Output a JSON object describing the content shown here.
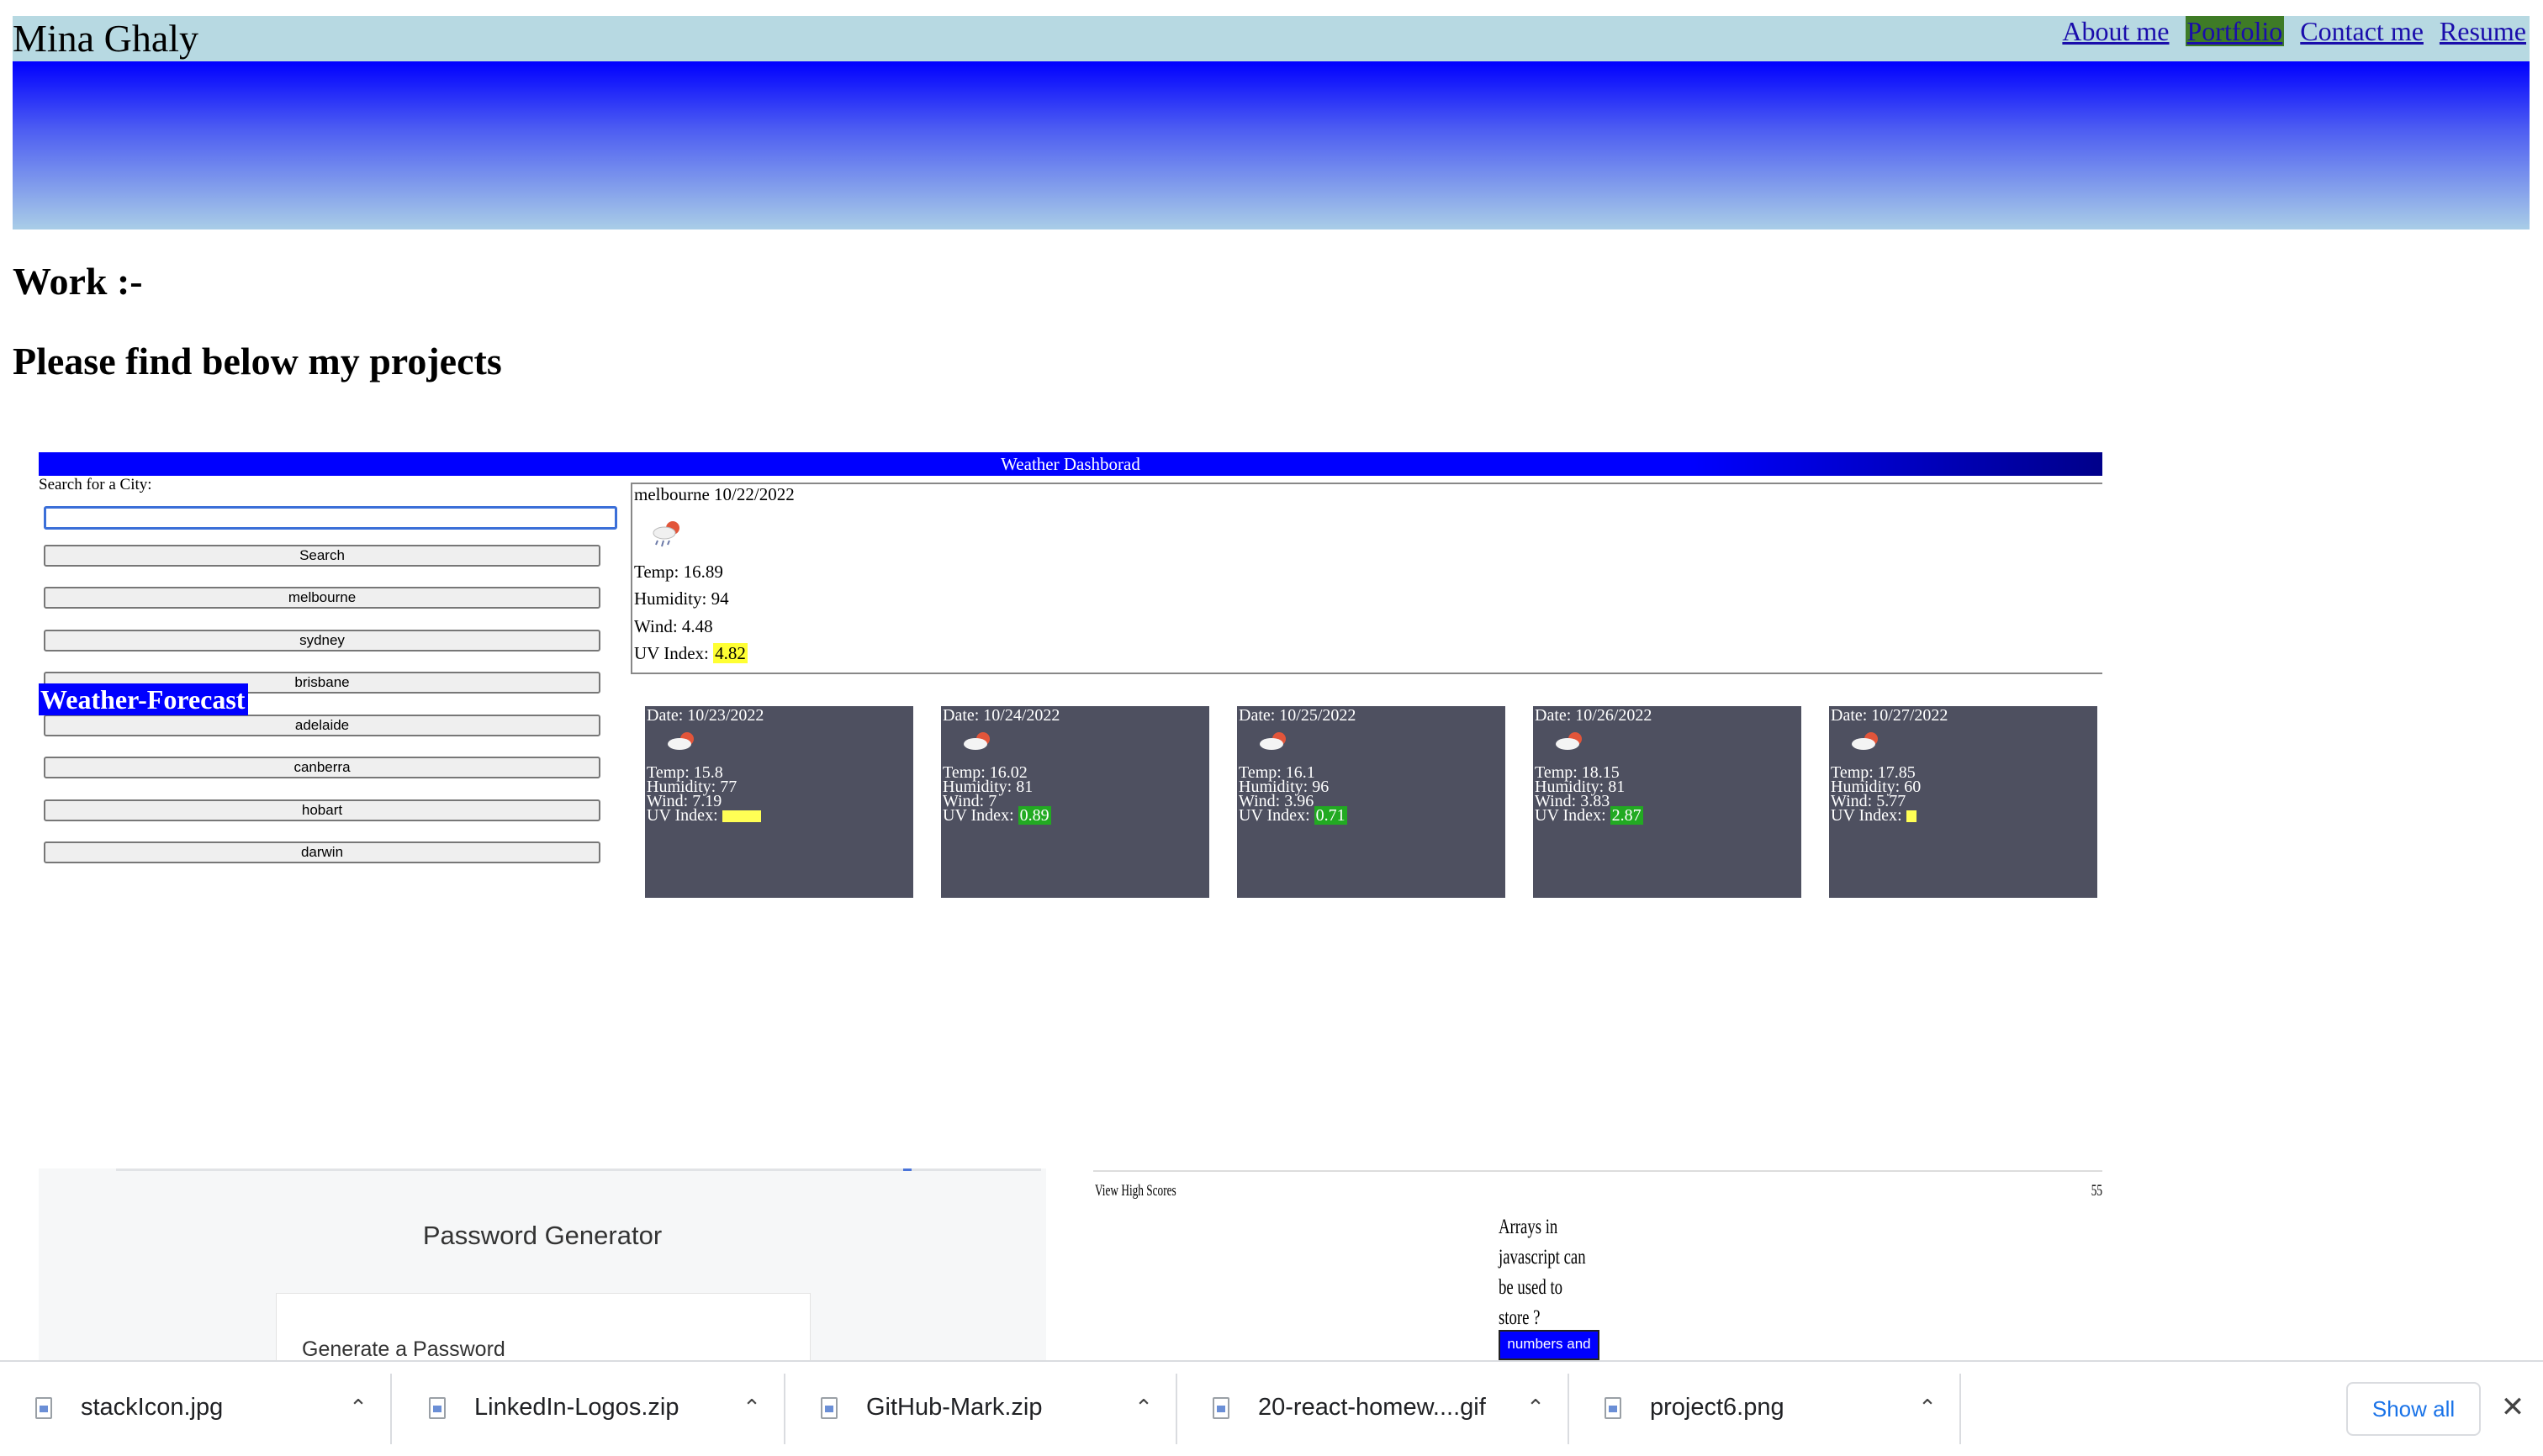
{
  "site": {
    "title": "Mina Ghaly",
    "nav": [
      "About me",
      "Portfolio",
      "Contact me",
      "Resume"
    ],
    "active_nav": "Portfolio"
  },
  "main": {
    "work_heading": "Work :-",
    "projects_heading": "Please find below my projects"
  },
  "weather_project": {
    "banner": "Weather Dashborad",
    "search_label": "Search for a City:",
    "search_button": "Search",
    "cities": [
      "melbourne",
      "sydney",
      "brisbane",
      "adelaide",
      "canberra",
      "hobart",
      "darwin"
    ],
    "forecast_label": "Weather-Forecast",
    "current": {
      "city_date": "melbourne 10/22/2022",
      "temp": "Temp: 16.89",
      "humidity": "Humidity: 94",
      "wind": "Wind: 4.48",
      "uv_label": "UV Index:",
      "uv_value": "4.82"
    },
    "forecast": [
      {
        "date": "Date: 10/23/2022",
        "temp": "Temp: 15.8",
        "humidity": "Humidity: 77",
        "wind": "Wind: 7.19",
        "uv_label": "UV Index:",
        "uv_value": "",
        "uv_level": "high"
      },
      {
        "date": "Date: 10/24/2022",
        "temp": "Temp: 16.02",
        "humidity": "Humidity: 81",
        "wind": "Wind: 7",
        "uv_label": "UV Index:",
        "uv_value": "0.89",
        "uv_level": "low"
      },
      {
        "date": "Date: 10/25/2022",
        "temp": "Temp: 16.1",
        "humidity": "Humidity: 96",
        "wind": "Wind: 3.96",
        "uv_label": "UV Index:",
        "uv_value": "0.71",
        "uv_level": "low"
      },
      {
        "date": "Date: 10/26/2022",
        "temp": "Temp: 18.15",
        "humidity": "Humidity: 81",
        "wind": "Wind: 3.83",
        "uv_label": "UV Index:",
        "uv_value": "2.87",
        "uv_level": "low"
      },
      {
        "date": "Date: 10/27/2022",
        "temp": "Temp: 17.85",
        "humidity": "Humidity: 60",
        "wind": "Wind: 5.77",
        "uv_label": "UV Index:",
        "uv_value": "",
        "uv_level": "high"
      }
    ],
    "icons": {
      "current": "rain-cloud-sun-icon",
      "forecast": "cloud-sun-icon"
    }
  },
  "password_project": {
    "title": "Password Generator",
    "card_title": "Generate a Password"
  },
  "quiz_project": {
    "high_scores": "View High Scores",
    "timer": "55",
    "question": "Arrays in javascript can be used to store ?",
    "answer": "numbers and strings"
  },
  "downloads": {
    "items": [
      "stackIcon.jpg",
      "LinkedIn-Logos.zip",
      "GitHub-Mark.zip",
      "20-react-homew....gif",
      "project6.png"
    ],
    "show_all": "Show all",
    "close_icon": "close-icon"
  },
  "colors": {
    "header_bg": "#b7d9e2",
    "active_nav_bg": "#3e7b26",
    "banner_blue": "#0000ff",
    "card_bg": "#4e5060",
    "uv_high": "#ffff33",
    "uv_low": "#22aa22",
    "link": "#1a0dab"
  }
}
